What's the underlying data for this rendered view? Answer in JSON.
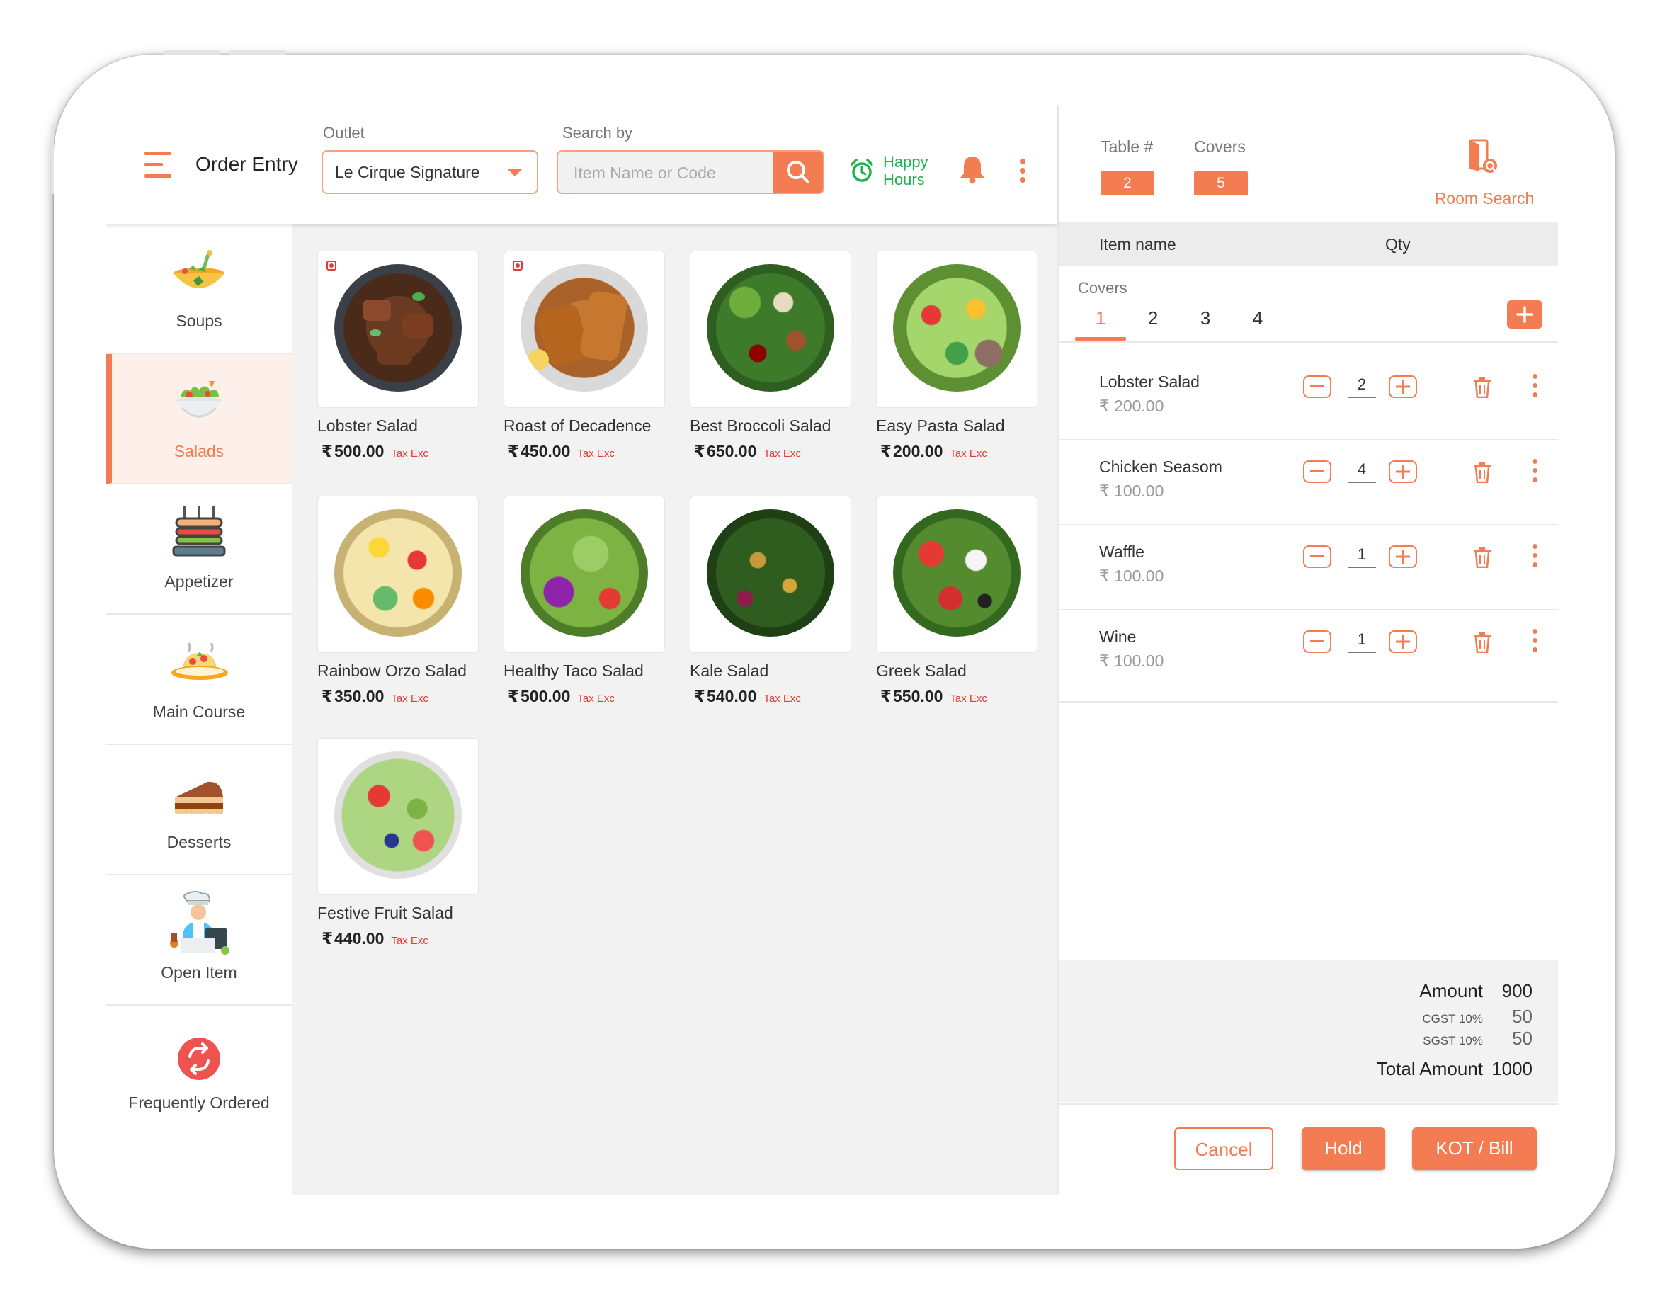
{
  "header": {
    "title": "Order Entry",
    "outlet_label": "Outlet",
    "outlet_value": "Le Cirque Signature",
    "search_label": "Search by",
    "search_placeholder": "Item Name or Code",
    "happy_hours_line1": "Happy",
    "happy_hours_line2": "Hours"
  },
  "categories": [
    {
      "label": "Soups",
      "icon": "soup-bowl-icon"
    },
    {
      "label": "Salads",
      "icon": "salad-bowl-icon",
      "active": true
    },
    {
      "label": "Appetizer",
      "icon": "skewer-appetizer-icon"
    },
    {
      "label": "Main Course",
      "icon": "pasta-plate-icon"
    },
    {
      "label": "Desserts",
      "icon": "cake-slice-icon"
    },
    {
      "label": "Open Item",
      "icon": "chef-icon"
    },
    {
      "label": "Frequently Ordered",
      "icon": "repeat-arrows-icon"
    }
  ],
  "currency_symbol": "₹",
  "tax_label": "Tax Exc",
  "items": [
    {
      "name": "Lobster Salad",
      "price": "500.00",
      "non_veg": true
    },
    {
      "name": "Roast of Decadence",
      "price": "450.00",
      "non_veg": true
    },
    {
      "name": "Best Broccoli Salad",
      "price": "650.00"
    },
    {
      "name": "Easy Pasta Salad",
      "price": "200.00"
    },
    {
      "name": "Rainbow Orzo Salad",
      "price": "350.00"
    },
    {
      "name": "Healthy Taco Salad",
      "price": "500.00"
    },
    {
      "name": "Kale Salad",
      "price": "540.00"
    },
    {
      "name": "Greek Salad",
      "price": "550.00"
    },
    {
      "name": "Festive Fruit Salad",
      "price": "440.00"
    }
  ],
  "order_panel": {
    "table_label": "Table #",
    "table_value": "2",
    "covers_label": "Covers",
    "covers_value": "5",
    "room_search_label": "Room Search",
    "col_item": "Item name",
    "col_qty": "Qty",
    "covers_section_label": "Covers",
    "cover_tabs": [
      "1",
      "2",
      "3",
      "4"
    ],
    "active_cover": "1",
    "lines": [
      {
        "name": "Lobster Salad",
        "price": "₹ 200.00",
        "qty": "2"
      },
      {
        "name": "Chicken Seasom",
        "price": "₹ 100.00",
        "qty": "4"
      },
      {
        "name": "Waffle",
        "price": "₹ 100.00",
        "qty": "1"
      },
      {
        "name": "Wine",
        "price": "₹ 100.00",
        "qty": "1"
      }
    ],
    "totals": {
      "amount_label": "Amount",
      "amount": "900",
      "cgst_label": "CGST 10%",
      "cgst": "50",
      "sgst_label": "SGST 10%",
      "sgst": "50",
      "total_label": "Total Amount",
      "total": "1000"
    },
    "buttons": {
      "cancel": "Cancel",
      "hold": "Hold",
      "kot_bill": "KOT / Bill"
    }
  },
  "colors": {
    "accent": "#f47c52",
    "happy_hours": "#22b14c",
    "tax": "#e53935"
  }
}
